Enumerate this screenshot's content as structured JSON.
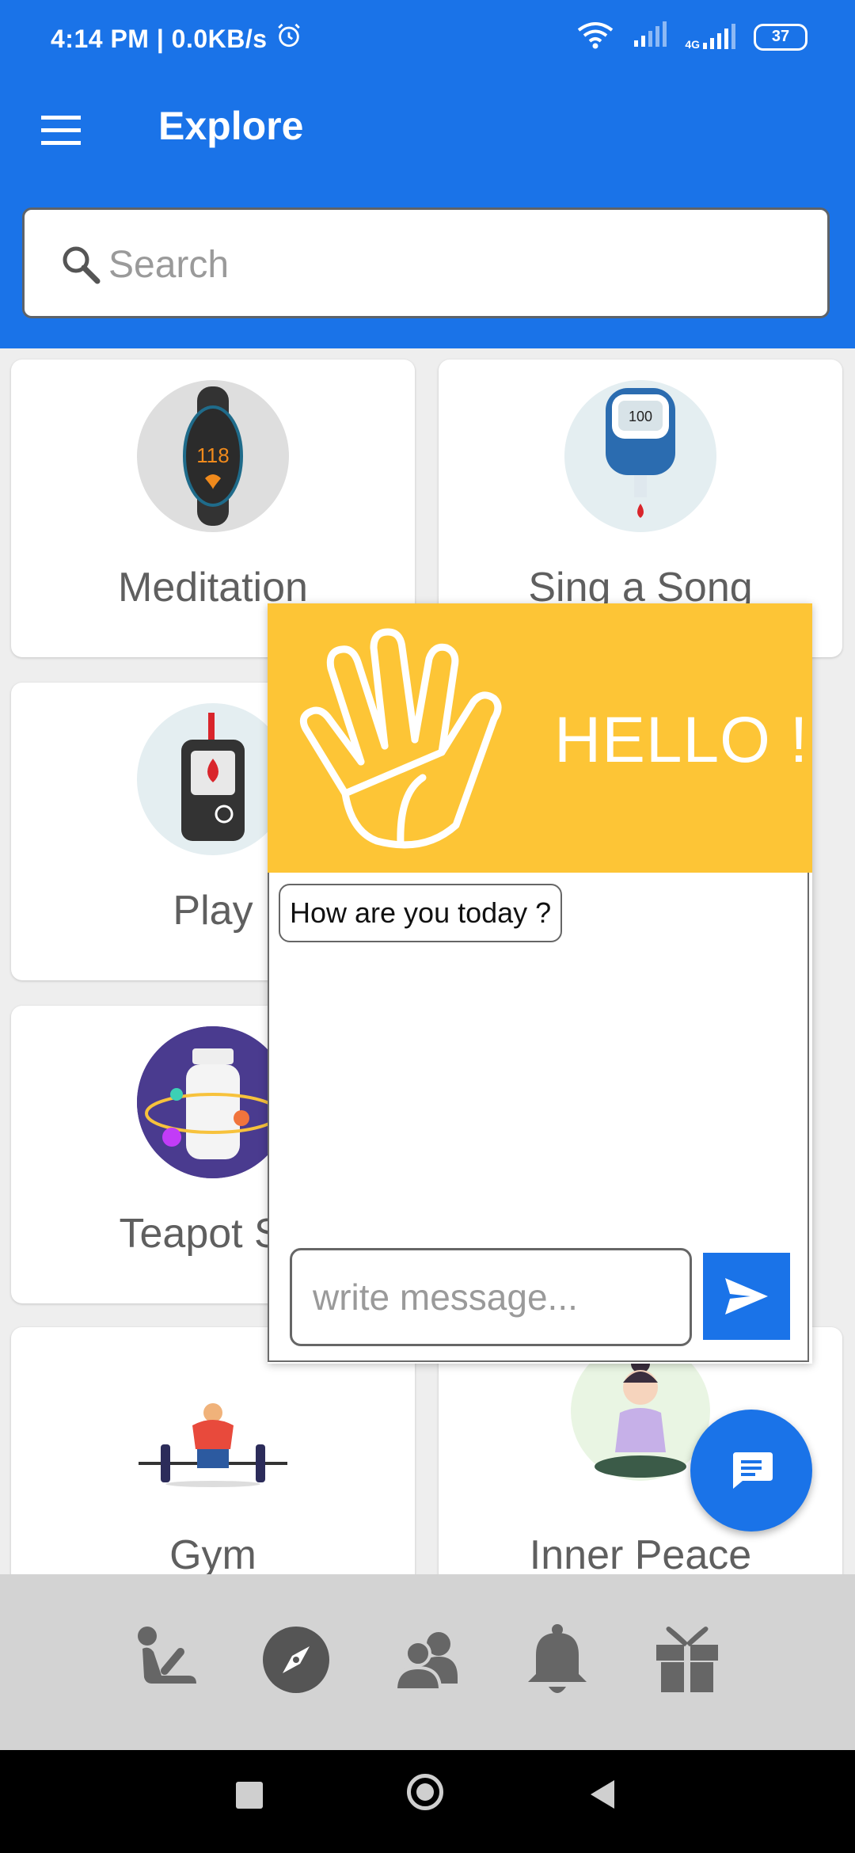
{
  "status_bar": {
    "time_speed": "4:14 PM | 0.0KB/s",
    "battery": "37",
    "network_type": "4G"
  },
  "app_bar": {
    "title": "Explore"
  },
  "search": {
    "placeholder": "Search"
  },
  "cards": [
    {
      "label": "Meditation",
      "icon": "fitness-watch-icon"
    },
    {
      "label": "Sing a Song",
      "icon": "glucose-meter-icon"
    },
    {
      "label": "Play",
      "icon": "blood-glucose-device-icon"
    },
    {
      "label": "Teapot Str",
      "icon": "vitamin-bottle-icon"
    },
    {
      "label": "Gym",
      "icon": "weightlifter-icon"
    },
    {
      "label": "Inner Peace",
      "icon": "meditating-person-icon"
    }
  ],
  "chat": {
    "header_text": "HELLO !",
    "message": "How are you today ?",
    "input_placeholder": "write message..."
  },
  "bottom_nav": [
    "exercise-icon",
    "compass-icon",
    "group-icon",
    "bell-icon",
    "gift-icon"
  ],
  "colors": {
    "primary": "#1a73e8",
    "popup_header": "#fdc536",
    "nav_bg": "#d3d3d3",
    "nav_icon": "#666666"
  }
}
